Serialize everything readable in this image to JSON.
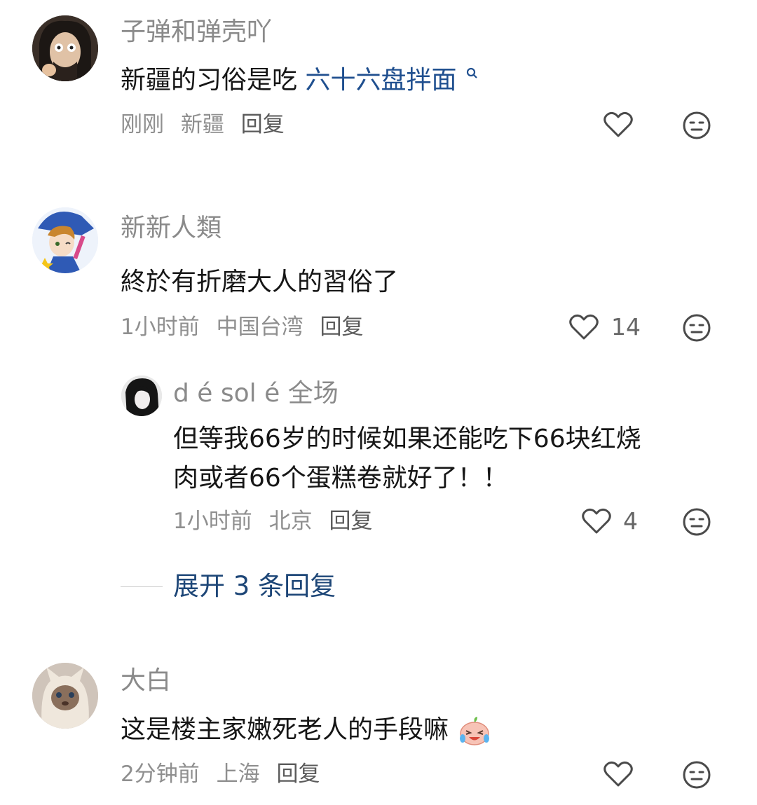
{
  "comments": [
    {
      "username": "子弹和弹壳吖",
      "text": "新疆的习俗是吃",
      "link_text": "六十六盘拌面",
      "time": "刚刚",
      "location": "新疆",
      "reply_label": "回复",
      "likes": ""
    },
    {
      "username": "新新人類",
      "text": "終於有折磨大人的習俗了",
      "time": "1小时前",
      "location": "中国台湾",
      "reply_label": "回复",
      "likes": "14",
      "replies": [
        {
          "username": "d é sol é",
          "tag": "全场",
          "text_line1": "但等我66岁的时候如果还能吃下66块红烧",
          "text_line2": "肉或者66个蛋糕卷就好了！！",
          "time": "1小时前",
          "location": "北京",
          "reply_label": "回复",
          "likes": "4"
        }
      ],
      "expand_label": "展开 3 条回复"
    },
    {
      "username": "大白",
      "text": "这是楼主家嫩死老人的手段嘛",
      "time": "2分钟前",
      "location": "上海",
      "reply_label": "回复",
      "likes": ""
    }
  ],
  "colors": {
    "username": "#8a8a8a",
    "text": "#161616",
    "link": "#1f4f8f",
    "meta": "#8f8f8f",
    "expand": "#1d4677"
  },
  "icons": {
    "search": "search-icon",
    "like": "heart-icon",
    "dislike": "meh-face-icon",
    "emoji": "crying-laughing-emoji-icon"
  }
}
